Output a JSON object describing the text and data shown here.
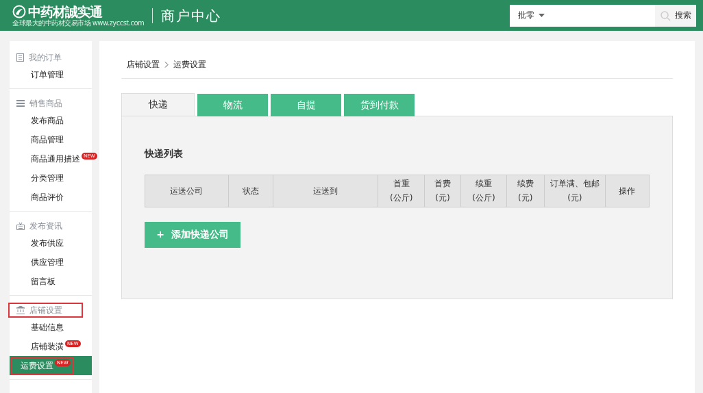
{
  "header": {
    "logo": "中药材誠实通",
    "slogan": "全球最大的中药材交易市场 www.zyccst.com",
    "title": "商户中心",
    "search": {
      "scope": "批零",
      "button": "搜索"
    }
  },
  "sidebar": [
    {
      "title": "我的订单",
      "highlighted": false,
      "items": [
        {
          "label": "订单管理",
          "selected": false,
          "highlighted": false
        }
      ]
    },
    {
      "title": "销售商品",
      "highlighted": false,
      "items": [
        {
          "label": "发布商品",
          "selected": false,
          "highlighted": false
        },
        {
          "label": "商品管理",
          "selected": false,
          "highlighted": false
        },
        {
          "label": "商品通用描述",
          "selected": false,
          "badge": "NEW",
          "highlighted": false
        },
        {
          "label": "分类管理",
          "selected": false,
          "highlighted": false
        },
        {
          "label": "商品评价",
          "selected": false,
          "highlighted": false
        }
      ]
    },
    {
      "title": "发布资讯",
      "highlighted": false,
      "items": [
        {
          "label": "发布供应",
          "selected": false,
          "highlighted": false
        },
        {
          "label": "供应管理",
          "selected": false,
          "highlighted": false
        },
        {
          "label": "留言板",
          "selected": false,
          "highlighted": false
        }
      ]
    },
    {
      "title": "店铺设置",
      "highlighted": true,
      "items": [
        {
          "label": "基础信息",
          "selected": false,
          "highlighted": false
        },
        {
          "label": "店铺装潢",
          "selected": false,
          "badge": "NEW",
          "highlighted": false
        },
        {
          "label": "运费设置",
          "selected": true,
          "badge": "NEW",
          "highlighted": true
        }
      ]
    }
  ],
  "breadcrumb": [
    "店铺设置",
    "运费设置"
  ],
  "tabs": [
    {
      "label": "快递",
      "selected": true
    },
    {
      "label": "物流",
      "selected": false
    },
    {
      "label": "自提",
      "selected": false
    },
    {
      "label": "货到付款",
      "selected": false
    }
  ],
  "section_title": "快递列表",
  "table": {
    "columns": [
      [
        "运送公司"
      ],
      [
        "状态"
      ],
      [
        "运送到"
      ],
      [
        "首重",
        "(公斤)"
      ],
      [
        "首费",
        "(元)"
      ],
      [
        "续重",
        "(公斤)"
      ],
      [
        "续费",
        "(元)"
      ],
      [
        "订单满、包邮",
        "(元)"
      ],
      [
        "操作"
      ]
    ]
  },
  "add_button": {
    "icon": "+",
    "label": "添加快递公司"
  }
}
